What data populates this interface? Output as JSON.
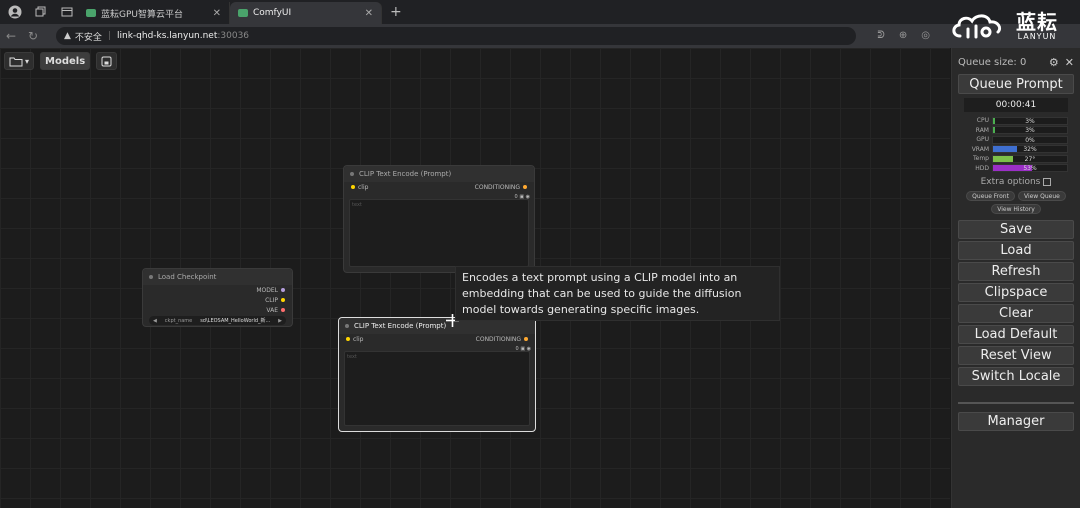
{
  "browser": {
    "tabs": [
      {
        "title": "蓝耘GPU智算云平台",
        "close": "✕"
      },
      {
        "title": "ComfyUI",
        "close": "✕"
      }
    ],
    "new_tab": "+",
    "address": {
      "security": "不安全",
      "host": "link-qhd-ks.lanyun.net",
      "port": ":30036"
    }
  },
  "logo": {
    "cn": "蓝耘",
    "en": "LANYUN"
  },
  "toolbar": {
    "folder_glyph": "▾",
    "models_label": "Models"
  },
  "nodes": {
    "clip_top": {
      "title": "CLIP Text Encode (Prompt)",
      "input": "clip",
      "output": "CONDITIONING",
      "text_placeholder": "text"
    },
    "load_checkpoint": {
      "title": "Load Checkpoint",
      "outputs": [
        "MODEL",
        "CLIP",
        "VAE"
      ],
      "widget_label": "ckpt_name",
      "widget_value": "sd\\LEOSAM_HelloWorld_新..."
    },
    "clip_bottom": {
      "title": "CLIP Text Encode (Prompt)",
      "input": "clip",
      "output": "CONDITIONING",
      "text_placeholder": "text"
    }
  },
  "tooltip": "Encodes a text prompt using a CLIP model into an embedding that can be used to guide the diffusion model towards generating specific images.",
  "panel": {
    "queue_size": "Queue size: 0",
    "queue_prompt": "Queue Prompt",
    "timer": "00:00:41",
    "stats": [
      {
        "label": "CPU",
        "value": "3%",
        "pct": 3,
        "color": "#4caf50"
      },
      {
        "label": "RAM",
        "value": "3%",
        "pct": 3,
        "color": "#4caf50"
      },
      {
        "label": "GPU",
        "value": "0%",
        "pct": 0,
        "color": "#4caf50"
      },
      {
        "label": "VRAM",
        "value": "32%",
        "pct": 32,
        "color": "#3f6fd0"
      },
      {
        "label": "Temp",
        "value": "27°",
        "pct": 27,
        "color": "#7cc04a"
      },
      {
        "label": "HDD",
        "value": "53%",
        "pct": 53,
        "color": "#9b2fc7"
      }
    ],
    "extra_options": "Extra options",
    "queue_front": "Queue Front",
    "view_queue": "View Queue",
    "view_history": "View History",
    "buttons": [
      "Save",
      "Load",
      "Refresh",
      "Clipspace",
      "Clear",
      "Load Default",
      "Reset View",
      "Switch Locale"
    ],
    "manager": "Manager"
  },
  "colors": {
    "clip": "#ffd500",
    "conditioning": "#ffa931",
    "model": "#b39ddb",
    "vae": "#ff6e6e"
  }
}
